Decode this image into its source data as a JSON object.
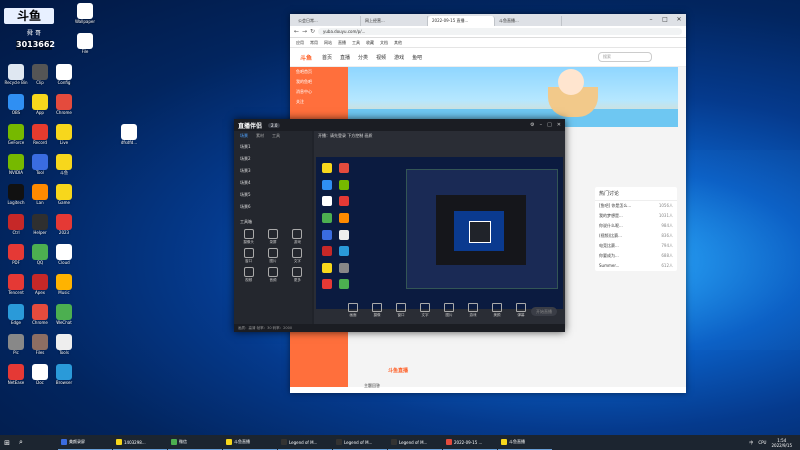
{
  "desktop": {
    "badge": {
      "top": "斗鱼",
      "number": "3013662",
      "name": "舜 哥"
    },
    "icons": [
      {
        "label": "Wallpaper",
        "color": "#ffffff"
      },
      {
        "label": "File",
        "color": "#ffffff"
      },
      {
        "label": "Recycle Bin",
        "color": "#dfe7f1"
      },
      {
        "label": "Clip",
        "color": "#555555"
      },
      {
        "label": "Config",
        "color": "#ffffff"
      },
      {
        "label": "OBS",
        "color": "#2f8ff3"
      },
      {
        "label": "App",
        "color": "#f7d71c"
      },
      {
        "label": "Chrome",
        "color": "#e44b3d"
      },
      {
        "label": "GeForce",
        "color": "#76b900"
      },
      {
        "label": "Record",
        "color": "#e63b2e"
      },
      {
        "label": "Live",
        "color": "#f7d71c"
      },
      {
        "label": "NVIDIA",
        "color": "#76b900"
      },
      {
        "label": "Tool",
        "color": "#3a6ce0"
      },
      {
        "label": "斗鱼",
        "color": "#f7d71c"
      },
      {
        "label": "Logitech",
        "color": "#111111"
      },
      {
        "label": "Lan",
        "color": "#ff8a00"
      },
      {
        "label": "Game",
        "color": "#f7d71c"
      },
      {
        "label": "Ctrl",
        "color": "#c62828"
      },
      {
        "label": "Helper",
        "color": "#2f2f2f"
      },
      {
        "label": "2023",
        "color": "#e53935"
      },
      {
        "label": "PDF",
        "color": "#e53935"
      },
      {
        "label": "QQ",
        "color": "#4caf50"
      },
      {
        "label": "Cloud",
        "color": "#ffffff"
      },
      {
        "label": "Tencent",
        "color": "#e53935"
      },
      {
        "label": "Apex",
        "color": "#c62828"
      },
      {
        "label": "Music",
        "color": "#ffb300"
      },
      {
        "label": "Edge",
        "color": "#2a9ad9"
      },
      {
        "label": "Chrome",
        "color": "#e44b3d"
      },
      {
        "label": "WeChat",
        "color": "#4caf50"
      },
      {
        "label": "Pic",
        "color": "#888888"
      },
      {
        "label": "Files",
        "color": "#8d6e63"
      },
      {
        "label": "Tools",
        "color": "#eeeeee"
      },
      {
        "label": "NetEase",
        "color": "#e53935"
      },
      {
        "label": "Doc",
        "color": "#ffffff"
      },
      {
        "label": "Browser",
        "color": "#2a9ad9"
      }
    ],
    "file_icon_label": "dfsdfd..."
  },
  "browser": {
    "tabs": [
      "公会日常...",
      "网上经营...",
      "2022-09-15 直播...",
      "斗鱼直播...",
      ""
    ],
    "address": "yuba.douyu.com/p/...",
    "bookmarks": [
      "应用",
      "常用",
      "网站",
      "直播",
      "工具",
      "收藏",
      "文档",
      "其他"
    ],
    "site": {
      "logo": "斗鱼",
      "nav": [
        "首页",
        "直播",
        "分类",
        "视频",
        "游戏",
        "鱼吧"
      ],
      "search_placeholder": "搜索",
      "left_menu": [
        "鱼吧首页",
        "我的鱼吧",
        "消息中心",
        "关注"
      ],
      "right_panel": {
        "title": "热门讨论",
        "items": [
          {
            "text": "[鱼吧] 你是怎么...",
            "n": "1056人"
          },
          {
            "text": "我的梦想是...",
            "n": "1031人"
          },
          {
            "text": "你说什么呢...",
            "n": "984人"
          },
          {
            "text": "(视频)比赛...",
            "n": "836人"
          },
          {
            "text": "电竞比赛...",
            "n": "794人"
          },
          {
            "text": "你要成为...",
            "n": "688人"
          },
          {
            "text": "Summer...",
            "n": "612人"
          }
        ]
      },
      "promo_label": "斗鱼直播",
      "section_label": "主题回答"
    }
  },
  "live_app": {
    "logo": "直播伴侣",
    "version": "2.0",
    "left_tabs": [
      "场景",
      "素材",
      "工具"
    ],
    "scenes": [
      "场景1",
      "场景2",
      "场景3",
      "场景4",
      "场景5",
      "场景6"
    ],
    "section_label": "工具箱",
    "tools": [
      "摄像头",
      "录屏",
      "游戏",
      "窗口",
      "图片",
      "文字",
      "视频",
      "音频",
      "更多"
    ],
    "main_header": "开播：请先登录   下方控制   画质",
    "toolbar": [
      "画面",
      "摄像",
      "窗口",
      "文字",
      "图片",
      "游戏",
      "美颜",
      "弹幕"
    ],
    "go_live": "开始直播",
    "footer": "画质：高清  帧率：30  码率：2000"
  },
  "taskbar": {
    "start": "⊞",
    "items": [
      {
        "label": "美颜录屏",
        "color": "#3a6ce0"
      },
      {
        "label": "1403298...",
        "color": "#f7d71c"
      },
      {
        "label": "微信",
        "color": "#4caf50"
      },
      {
        "label": "斗鱼直播",
        "color": "#f7d71c"
      },
      {
        "label": "Legend of M...",
        "color": "#333333"
      },
      {
        "label": "Legend of M...",
        "color": "#333333"
      },
      {
        "label": "Legend of M...",
        "color": "#333333"
      },
      {
        "label": "2022-09-15 ...",
        "color": "#e44b3d"
      },
      {
        "label": "斗鱼直播",
        "color": "#f7d71c"
      }
    ],
    "tray": {
      "ime": "中",
      "cpu": "CPU",
      "time": "1:54",
      "date": "2022/9/15"
    }
  }
}
